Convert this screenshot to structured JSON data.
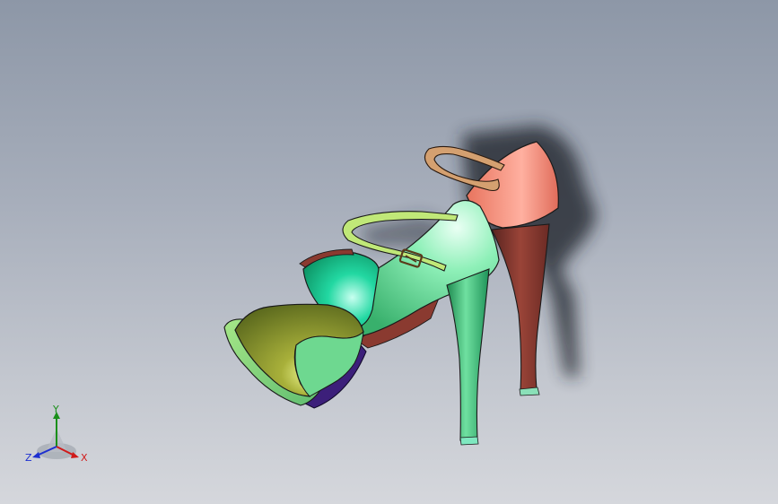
{
  "viewport": {
    "background_top": "#8d97a7",
    "background_bottom": "#d5d7dc",
    "model": "high-heel-sandal",
    "shadow_color": "#2a2d33"
  },
  "parts": {
    "front_strap_color": "#8f9a2e",
    "toe_strap_color": "#1fcf9a",
    "upper_color": "#7fe8a8",
    "heel_counter_color": "#f08878",
    "back_heel_color": "#8a3a30",
    "front_heel_color": "#36b070",
    "ankle_strap_color": "#d4a070",
    "instep_strap_color": "#b8e070",
    "platform_color": "#4a2a8a"
  },
  "triad": {
    "y_label": "Y",
    "z_label": "Z",
    "x_label": "X",
    "x_color": "#d01a1a",
    "y_color": "#1a8f1a",
    "z_color": "#1d2fd0"
  }
}
